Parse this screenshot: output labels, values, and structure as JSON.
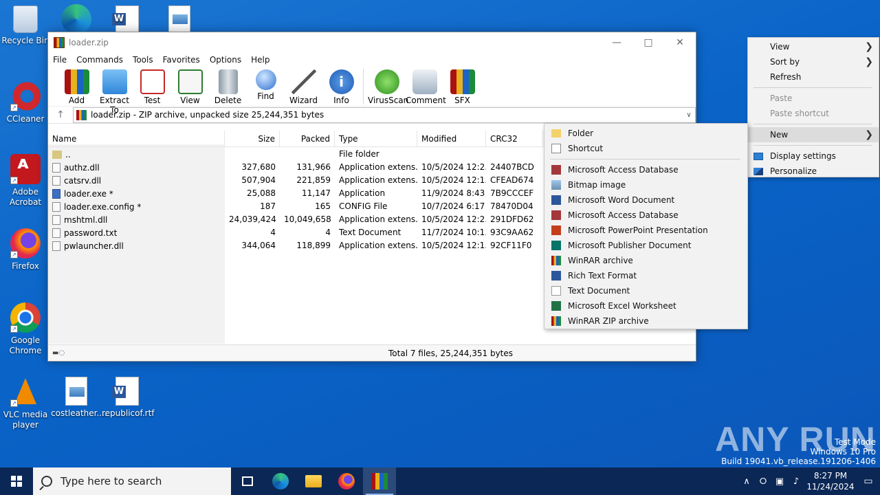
{
  "desktop": {
    "icons": [
      {
        "label": "Recycle Bin"
      },
      {
        "label": "CCleaner"
      },
      {
        "label": "Adobe Acrobat"
      },
      {
        "label": "Firefox"
      },
      {
        "label": "Google Chrome"
      },
      {
        "label": "VLC media player"
      },
      {
        "label": "costleather...."
      },
      {
        "label": "republicof.rtf"
      }
    ]
  },
  "winrar": {
    "title": "loader.zip",
    "menu": [
      "File",
      "Commands",
      "Tools",
      "Favorites",
      "Options",
      "Help"
    ],
    "toolbar": [
      "Add",
      "Extract To",
      "Test",
      "View",
      "Delete",
      "Find",
      "Wizard",
      "Info",
      "VirusScan",
      "Comment",
      "SFX"
    ],
    "address": "loader.zip - ZIP archive, unpacked size 25,244,351 bytes",
    "columns": [
      "Name",
      "Size",
      "Packed",
      "Type",
      "Modified",
      "CRC32"
    ],
    "rows": [
      {
        "name": "..",
        "size": "",
        "packed": "",
        "type": "File folder",
        "modified": "",
        "crc": "",
        "icon": "folder"
      },
      {
        "name": "authz.dll",
        "size": "327,680",
        "packed": "131,966",
        "type": "Application extens...",
        "modified": "10/5/2024 12:2...",
        "crc": "24407BCD",
        "icon": "dll"
      },
      {
        "name": "catsrv.dll",
        "size": "507,904",
        "packed": "221,859",
        "type": "Application extens...",
        "modified": "10/5/2024 12:1...",
        "crc": "CFEAD674",
        "icon": "dll"
      },
      {
        "name": "loader.exe *",
        "size": "25,088",
        "packed": "11,147",
        "type": "Application",
        "modified": "11/9/2024 8:43 ...",
        "crc": "7B9CCCEF",
        "icon": "exe"
      },
      {
        "name": "loader.exe.config *",
        "size": "187",
        "packed": "165",
        "type": "CONFIG File",
        "modified": "10/7/2024 6:17 ...",
        "crc": "78470D04",
        "icon": "file"
      },
      {
        "name": "mshtml.dll",
        "size": "24,039,424",
        "packed": "10,049,658",
        "type": "Application extens...",
        "modified": "10/5/2024 12:2...",
        "crc": "291DFD62",
        "icon": "dll"
      },
      {
        "name": "password.txt",
        "size": "4",
        "packed": "4",
        "type": "Text Document",
        "modified": "11/7/2024 10:1...",
        "crc": "93C9AA62",
        "icon": "file"
      },
      {
        "name": "pwlauncher.dll",
        "size": "344,064",
        "packed": "118,899",
        "type": "Application extens...",
        "modified": "10/5/2024 12:1...",
        "crc": "92CF11F0",
        "icon": "dll"
      }
    ],
    "status": "Total 7 files, 25,244,351 bytes"
  },
  "context_menu": {
    "view": "View",
    "sort_by": "Sort by",
    "refresh": "Refresh",
    "paste": "Paste",
    "paste_shortcut": "Paste shortcut",
    "new": "New",
    "display_settings": "Display settings",
    "personalize": "Personalize"
  },
  "new_submenu": {
    "folder": "Folder",
    "shortcut": "Shortcut",
    "items": [
      {
        "label": "Microsoft Access Database",
        "color": "#a4373a"
      },
      {
        "label": "Bitmap image",
        "color": "#8a8a8a"
      },
      {
        "label": "Microsoft Word Document",
        "color": "#2b579a"
      },
      {
        "label": "Microsoft Access Database",
        "color": "#a4373a"
      },
      {
        "label": "Microsoft PowerPoint Presentation",
        "color": "#c43e1c"
      },
      {
        "label": "Microsoft Publisher Document",
        "color": "#077568"
      },
      {
        "label": "WinRAR archive",
        "color": "#8b1a1a"
      },
      {
        "label": "Rich Text Format",
        "color": "#2b579a"
      },
      {
        "label": "Text Document",
        "color": "#9a9a9a"
      },
      {
        "label": "Microsoft Excel Worksheet",
        "color": "#217346"
      },
      {
        "label": "WinRAR ZIP archive",
        "color": "#8b1a1a"
      }
    ]
  },
  "taskbar": {
    "search_placeholder": "Type here to search",
    "time": "8:27 PM",
    "date": "11/24/2024"
  },
  "watermark": {
    "brand": "ANY RUN",
    "line1": "Test Mode",
    "line2": "Windows 10 Pro",
    "line3": "Build 19041.vb_release.191206-1406"
  }
}
